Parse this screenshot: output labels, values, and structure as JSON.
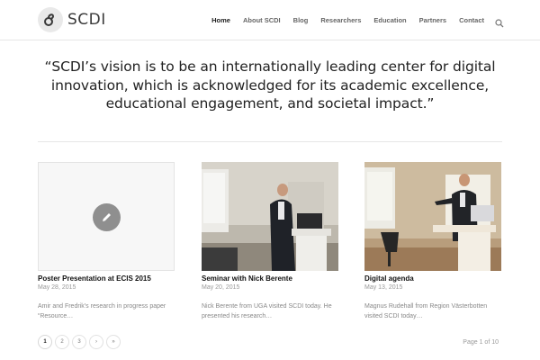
{
  "header": {
    "logo_text": "SCDI",
    "nav": [
      "Home",
      "About SCDI",
      "Blog",
      "Researchers",
      "Education",
      "Partners",
      "Contact"
    ]
  },
  "quote": "“SCDI’s vision is to be an internationally leading center for digital innovation, which is acknowledged for its academic excellence, educational engagement, and societal impact.”",
  "posts": [
    {
      "title": "Poster Presentation at ECIS 2015",
      "date": "May 28, 2015",
      "excerpt": "Amir and Fredrik’s  research in progress paper “Resource…",
      "image": "placeholder-pencil-icon"
    },
    {
      "title": "Seminar with Nick Berente",
      "date": "May 20, 2015",
      "excerpt": "Nick Berente from UGA visited SCDI today. He presented his research…",
      "image": "photo-speaker-at-podium"
    },
    {
      "title": "Digital agenda",
      "date": "May 13, 2015",
      "excerpt": "Magnus Rudehall from Region Västerbotten visited SCDI today…",
      "image": "photo-speaker-presenting"
    }
  ],
  "pagination": {
    "pages": [
      "1",
      "2",
      "3",
      "›",
      "»"
    ],
    "info": "Page 1 of 10"
  },
  "colors": {
    "text_dark": "#222222",
    "meta_grey": "#999999",
    "divider": "#e6e6e6"
  }
}
